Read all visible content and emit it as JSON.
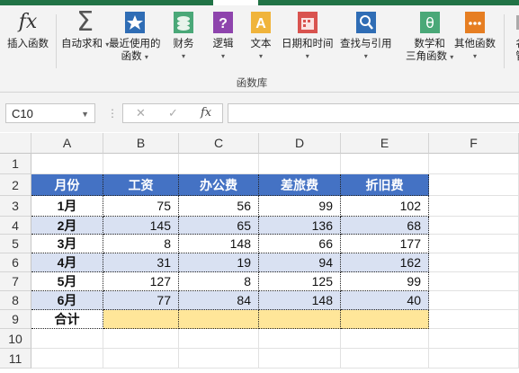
{
  "ribbon": {
    "insert_function": "插入函数",
    "autosum": "自动求和",
    "recent_line1": "最近使用的",
    "recent_line2": "函数",
    "financial": "财务",
    "logical": "逻辑",
    "text": "文本",
    "datetime": "日期和时间",
    "lookup": "查找与引用",
    "math_line1": "数学和",
    "math_line2": "三角函数",
    "more": "其他函数",
    "name_mgr_line1": "名",
    "name_mgr_line2": "管",
    "group_label": "函数库"
  },
  "formula_bar": {
    "name_box": "C10",
    "cancel": "✕",
    "enter": "✓",
    "fx": "fx",
    "value": ""
  },
  "columns": [
    "A",
    "B",
    "C",
    "D",
    "E",
    "F"
  ],
  "rows": [
    "1",
    "2",
    "3",
    "4",
    "5",
    "6",
    "7",
    "8",
    "9",
    "10",
    "11"
  ],
  "table": {
    "headers": [
      "月份",
      "工资",
      "办公费",
      "差旅费",
      "折旧费"
    ],
    "data": [
      [
        "1月",
        "75",
        "56",
        "99",
        "102"
      ],
      [
        "2月",
        "145",
        "65",
        "136",
        "68"
      ],
      [
        "3月",
        "8",
        "148",
        "66",
        "177"
      ],
      [
        "4月",
        "31",
        "19",
        "94",
        "162"
      ],
      [
        "5月",
        "127",
        "8",
        "125",
        "99"
      ],
      [
        "6月",
        "77",
        "84",
        "148",
        "40"
      ]
    ],
    "total_label": "合计"
  },
  "colors": {
    "header_blue": "#4472c4",
    "band_blue": "#d9e1f2",
    "total_yellow": "#ffe699",
    "excel_green": "#217346"
  }
}
